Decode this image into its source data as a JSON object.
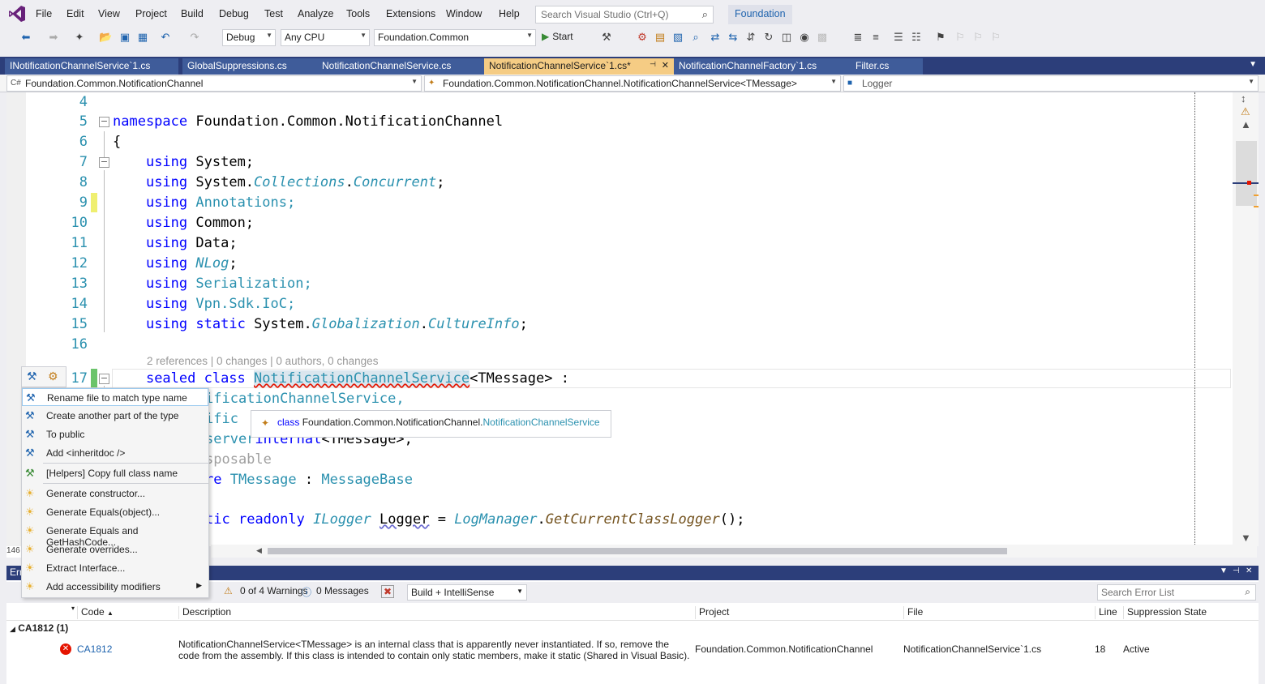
{
  "menubar": {
    "items": [
      "File",
      "Edit",
      "View",
      "Project",
      "Build",
      "Debug",
      "Test",
      "Analyze",
      "Tools",
      "Extensions",
      "Window",
      "Help"
    ],
    "search_placeholder": "Search Visual Studio (Ctrl+Q)",
    "solution_name": "Foundation"
  },
  "toolbar": {
    "config": "Debug",
    "platform": "Any CPU",
    "startup_project": "Foundation.Common",
    "start_label": "Start"
  },
  "tabs": [
    {
      "label": "INotificationChannelService`1.cs",
      "active": false
    },
    {
      "label": "GlobalSuppressions.cs",
      "active": false
    },
    {
      "label": "NotificationChannelService.cs",
      "active": false
    },
    {
      "label": "NotificationChannelService`1.cs*",
      "active": true
    },
    {
      "label": "NotificationChannelFactory`1.cs",
      "active": false
    },
    {
      "label": "Filter.cs",
      "active": false
    }
  ],
  "navbar": {
    "project": "Foundation.Common.NotificationChannel",
    "type": "Foundation.Common.NotificationChannel.NotificationChannelService<TMessage>",
    "member": "Logger"
  },
  "editor": {
    "line_numbers": [
      "4",
      "5",
      "6",
      "7",
      "8",
      "9",
      "10",
      "11",
      "12",
      "13",
      "14",
      "15",
      "16",
      "17"
    ],
    "codelens": "2 references | 0 changes | 0 authors, 0 changes",
    "line5_kw": "namespace",
    "line5_name": "Foundation.Common.NotificationChannel",
    "line6": "{",
    "line_using_kw": "using",
    "line7": "System;",
    "line8_a": "System.",
    "line8_b": "Collections",
    "line8_c": ".",
    "line8_d": "Concurrent",
    "line8_e": ";",
    "line9": "Annotations;",
    "line10": "Common;",
    "line11": "Data;",
    "line12_a": "NLog",
    "line12_b": ";",
    "line13": "Serialization;",
    "line14": "Vpn.Sdk.IoC;",
    "line15_static": "static",
    "line15_a": "System.",
    "line15_b": "Globalization",
    "line15_c": ".",
    "line15_d": "CultureInfo",
    "line15_e": ";",
    "line17_kw": "sealed class",
    "line17_name": "NotificationChannelService",
    "line17_rest": "<TMessage> :",
    "line18": "ificationChannelService,",
    "line19": "ific",
    "line20": "server",
    "line20_b": "internal",
    "line20_c": "<TMessage>,",
    "line21": "sposable",
    "line22_a": "re",
    "line22_b": "TMessage",
    "line22_c": ":",
    "line22_d": "MessageBase",
    "line24_a": "tic",
    "line24_b": "readonly",
    "line24_c": "ILogger",
    "line24_d": "Logger",
    "line24_e": "=",
    "line24_f": "LogManager",
    "line24_g": ".",
    "line24_h": "GetCurrentClassLogger",
    "line24_i": "();"
  },
  "zoom": "146",
  "quick_actions": {
    "items": [
      {
        "label": "Rename file to match type name",
        "icon": "screwdriver-icon"
      },
      {
        "label": "Create another part of the type",
        "icon": "screwdriver-icon"
      },
      {
        "label": "To public",
        "icon": "screwdriver-icon"
      },
      {
        "label": "Add <inheritdoc />",
        "icon": "screwdriver-icon"
      },
      {
        "label": "[Helpers] Copy full class name",
        "icon": "screwdriver-green-icon"
      },
      {
        "label": "Generate constructor...",
        "icon": "lightbulb-icon"
      },
      {
        "label": "Generate Equals(object)...",
        "icon": "lightbulb-icon"
      },
      {
        "label": "Generate Equals and GetHashCode...",
        "icon": "lightbulb-icon"
      },
      {
        "label": "Generate overrides...",
        "icon": "lightbulb-icon"
      },
      {
        "label": "Extract Interface...",
        "icon": "lightbulb-icon"
      },
      {
        "label": "Add accessibility modifiers",
        "icon": "lightbulb-icon"
      }
    ]
  },
  "tooltip": {
    "kind": "class",
    "namespace": "Foundation.Common.NotificationChannel.",
    "name": "NotificationChannelService"
  },
  "errorlist": {
    "title": "Err",
    "warnings": "0 of 4 Warnings",
    "messages": "0 Messages",
    "scope": "Build + IntelliSense",
    "search_placeholder": "Search Error List",
    "columns": [
      "Code",
      "Description",
      "Project",
      "File",
      "Line",
      "Suppression State"
    ],
    "group": "CA1812  (1)",
    "rows": [
      {
        "code": "CA1812",
        "description": "NotificationChannelService<TMessage> is an internal class that is apparently never instantiated. If so, remove the code from the assembly. If this class is intended to contain only static members, make it static (Shared in Visual Basic).",
        "project": "Foundation.Common.NotificationChannel",
        "file": "NotificationChannelService`1.cs",
        "line": "18",
        "state": "Active"
      }
    ]
  },
  "colors": {
    "tab_bar": "#2c3e7a",
    "active_tab": "#f5cc84",
    "keyword": "#0000ff",
    "type": "#2b91af",
    "error": "#e51400"
  }
}
